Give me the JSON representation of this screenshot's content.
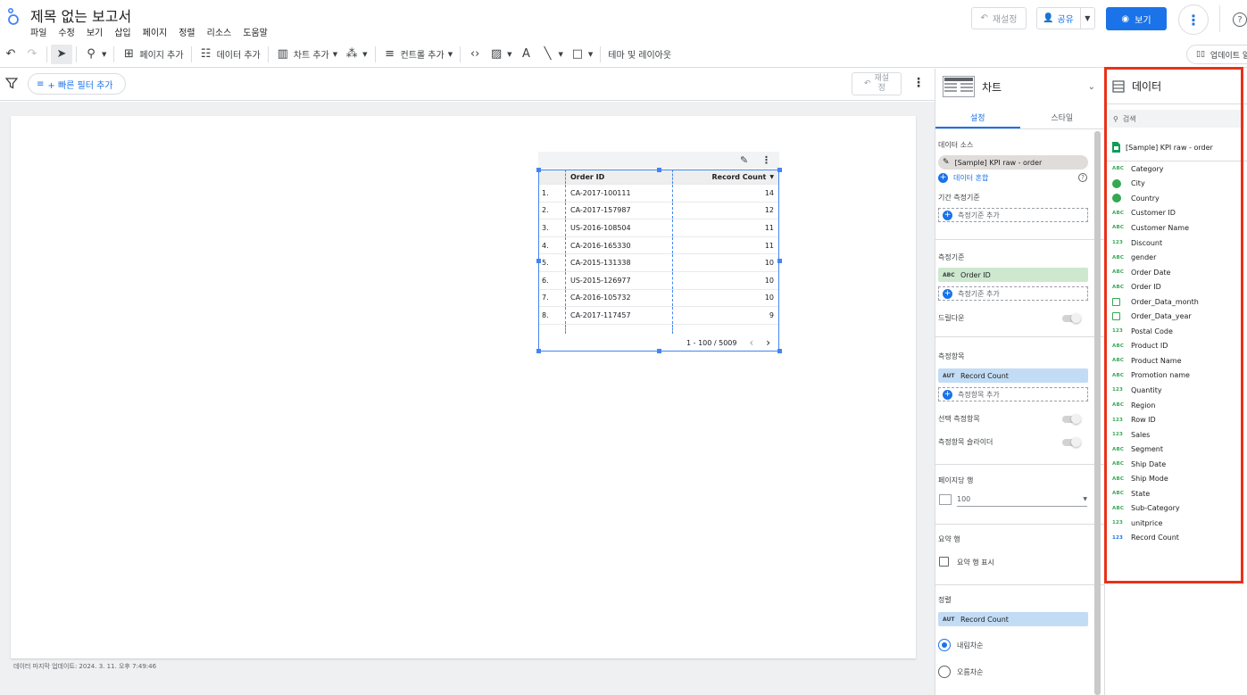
{
  "header": {
    "title": "제목 없는 보고서",
    "menu": [
      "파일",
      "수정",
      "보기",
      "삽입",
      "페이지",
      "정렬",
      "리소스",
      "도움말"
    ],
    "reset_label": "재설정",
    "share_label": "공유",
    "view_label": "보기"
  },
  "toolbar": {
    "add_page": "페이지 추가",
    "add_data": "데이터 추가",
    "add_chart": "차트 추가",
    "add_control": "컨트롤 추가",
    "theme_layout": "테마 및 레이아웃",
    "update": "업데이트 알"
  },
  "filterbar": {
    "quick_filter": "+ 빠른 필터 추가",
    "reset_label_1": "재설",
    "reset_label_2": "정"
  },
  "canvas": {
    "last_updated": "데이터 마지막 업데이트: 2024. 3. 11. 오후 7:49:46"
  },
  "table": {
    "columns": [
      "Order ID",
      "Record Count"
    ],
    "rows": [
      {
        "n": "1.",
        "id": "CA-2017-100111",
        "count": "14"
      },
      {
        "n": "2.",
        "id": "CA-2017-157987",
        "count": "12"
      },
      {
        "n": "3.",
        "id": "US-2016-108504",
        "count": "11"
      },
      {
        "n": "4.",
        "id": "CA-2016-165330",
        "count": "11"
      },
      {
        "n": "5.",
        "id": "CA-2015-131338",
        "count": "10"
      },
      {
        "n": "6.",
        "id": "US-2015-126977",
        "count": "10"
      },
      {
        "n": "7.",
        "id": "CA-2016-105732",
        "count": "10"
      },
      {
        "n": "8.",
        "id": "CA-2017-117457",
        "count": "9"
      }
    ],
    "pagination": "1 - 100 / 5009"
  },
  "chart_panel": {
    "title": "차트",
    "tabs": [
      "설정",
      "스타일"
    ],
    "data_source_label": "데이터 소스",
    "data_source": "[Sample] KPI raw - order",
    "blend": "데이터 혼합",
    "date_range_label": "기간 측정기준",
    "add_dimension": "측정기준 추가",
    "dimension_label": "측정기준",
    "dimension_value": "Order ID",
    "drilldown": "드릴다운",
    "metric_label": "측정항목",
    "metric_value": "Record Count",
    "add_metric": "측정항목 추가",
    "optional_metric": "선택 측정항목",
    "metric_slider": "측정항목 슬라이더",
    "rows_per_page_label": "페이지당 행",
    "rows_per_page": "100",
    "summary_label": "요약 행",
    "show_summary": "요약 행 표시",
    "sort_label": "정렬",
    "sort_value": "Record Count",
    "desc": "내림차순",
    "asc": "오름차순",
    "abc_tag": "ABC",
    "aut_tag": "AUT"
  },
  "data_panel": {
    "title": "데이터",
    "search_placeholder": "검색",
    "source": "[Sample] KPI raw - order",
    "fields": [
      {
        "name": "Category",
        "type": "ABC"
      },
      {
        "name": "City",
        "type": "geo"
      },
      {
        "name": "Country",
        "type": "geo"
      },
      {
        "name": "Customer ID",
        "type": "ABC"
      },
      {
        "name": "Customer Name",
        "type": "ABC"
      },
      {
        "name": "Discount",
        "type": "123"
      },
      {
        "name": "gender",
        "type": "ABC"
      },
      {
        "name": "Order Date",
        "type": "ABC"
      },
      {
        "name": "Order ID",
        "type": "ABC"
      },
      {
        "name": "Order_Data_month",
        "type": "date"
      },
      {
        "name": "Order_Data_year",
        "type": "date"
      },
      {
        "name": "Postal Code",
        "type": "123"
      },
      {
        "name": "Product ID",
        "type": "ABC"
      },
      {
        "name": "Product Name",
        "type": "ABC"
      },
      {
        "name": "Promotion name",
        "type": "ABC"
      },
      {
        "name": "Quantity",
        "type": "123"
      },
      {
        "name": "Region",
        "type": "ABC"
      },
      {
        "name": "Row ID",
        "type": "123"
      },
      {
        "name": "Sales",
        "type": "123"
      },
      {
        "name": "Segment",
        "type": "ABC"
      },
      {
        "name": "Ship Date",
        "type": "ABC"
      },
      {
        "name": "Ship Mode",
        "type": "ABC"
      },
      {
        "name": "State",
        "type": "ABC"
      },
      {
        "name": "Sub-Category",
        "type": "ABC"
      },
      {
        "name": "unitprice",
        "type": "123"
      },
      {
        "name": "Record Count",
        "type": "123b"
      }
    ]
  },
  "colors": {
    "accent": "#1a73e8",
    "highlight": "#e8321a",
    "dimension": "#cde8cf",
    "metric": "#c2dcf5"
  }
}
